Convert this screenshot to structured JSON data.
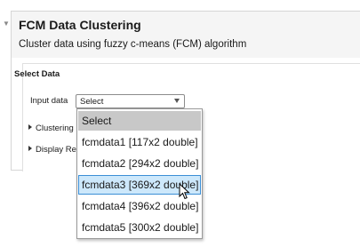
{
  "task": {
    "title": "FCM Data Clustering",
    "subtitle": "Cluster data using fuzzy c-means (FCM) algorithm"
  },
  "select_data": {
    "heading": "Select Data",
    "input_label": "Input data",
    "selected_value": "Select"
  },
  "sections": {
    "clustering": "Clustering",
    "display": "Display Re"
  },
  "dropdown": {
    "options": [
      "Select",
      "fcmdata1 [117x2 double]",
      "fcmdata2 [294x2 double]",
      "fcmdata3 [369x2 double]",
      "fcmdata4 [396x2 double]",
      "fcmdata5 [300x2 double]"
    ],
    "hovered_option": "fcmdata3 [369x2 double]"
  },
  "icons": {
    "task_chevron": "chevron-down-icon",
    "cursor": "mouse-pointer-icon"
  },
  "colors": {
    "hover_fill": "#cde8fb",
    "hover_border": "#3c8fd6",
    "first_option_fill": "#c8c8c8",
    "header_fill": "#f5f5f5"
  }
}
